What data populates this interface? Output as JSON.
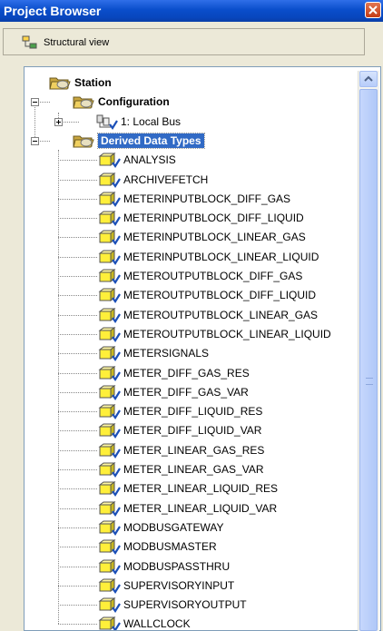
{
  "window": {
    "title": "Project Browser"
  },
  "toolbar": {
    "structural_view_label": "Structural view"
  },
  "tree": {
    "root": {
      "label": "Station",
      "expanded": true
    },
    "configuration": {
      "label": "Configuration",
      "expanded": true
    },
    "local_bus": {
      "label": "1: Local Bus",
      "expanded": false
    },
    "derived": {
      "label": "Derived Data Types",
      "expanded": true,
      "selected": true
    },
    "items": [
      "ANALYSIS",
      "ARCHIVEFETCH",
      "METERINPUTBLOCK_DIFF_GAS",
      "METERINPUTBLOCK_DIFF_LIQUID",
      "METERINPUTBLOCK_LINEAR_GAS",
      "METERINPUTBLOCK_LINEAR_LIQUID",
      "METEROUTPUTBLOCK_DIFF_GAS",
      "METEROUTPUTBLOCK_DIFF_LIQUID",
      "METEROUTPUTBLOCK_LINEAR_GAS",
      "METEROUTPUTBLOCK_LINEAR_LIQUID",
      "METERSIGNALS",
      "METER_DIFF_GAS_RES",
      "METER_DIFF_GAS_VAR",
      "METER_DIFF_LIQUID_RES",
      "METER_DIFF_LIQUID_VAR",
      "METER_LINEAR_GAS_RES",
      "METER_LINEAR_GAS_VAR",
      "METER_LINEAR_LIQUID_RES",
      "METER_LINEAR_LIQUID_VAR",
      "MODBUSGATEWAY",
      "MODBUSMASTER",
      "MODBUSPASSTHRU",
      "SUPERVISORYINPUT",
      "SUPERVISORYOUTPUT",
      "WALLCLOCK"
    ]
  },
  "colors": {
    "titlebar": "#0a4ecb",
    "selection": "#316ac5",
    "folder": "#f0d060",
    "datatype_cube": "#ffef3a"
  },
  "icons": {
    "close": "close-icon",
    "structural_view": "structural-view-icon",
    "folder": "folder-icon",
    "bus": "bus-icon",
    "datatype": "datatype-icon"
  }
}
